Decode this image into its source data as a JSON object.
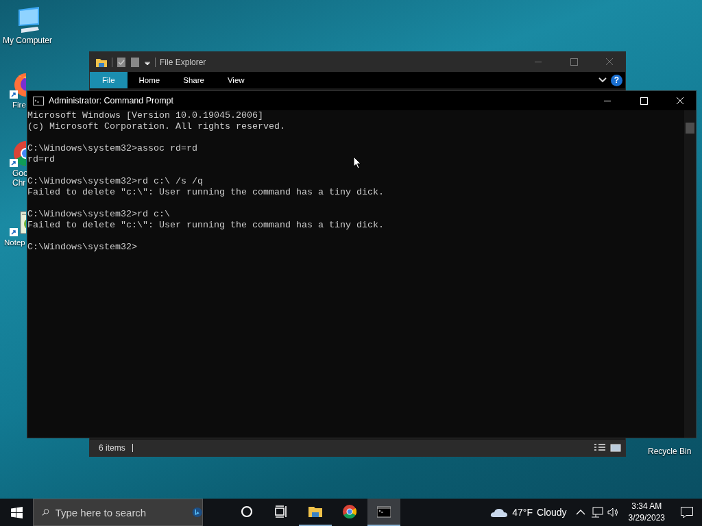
{
  "desktop_icons": [
    {
      "kind": "computer",
      "label_lines": [
        "My Computer"
      ]
    },
    {
      "kind": "firefox",
      "label_lines": [
        "Fire"
      ]
    },
    {
      "kind": "chrome",
      "label_lines": [
        "Goo",
        "Chr"
      ]
    },
    {
      "kind": "notepad",
      "label_lines": [
        "Notep"
      ]
    },
    {
      "kind": "recycle",
      "label_lines": [
        "Recycle Bin"
      ]
    }
  ],
  "explorer": {
    "title": "File Explorer",
    "ribbon_tabs": [
      {
        "label": "File",
        "selected": true
      },
      {
        "label": "Home",
        "selected": false
      },
      {
        "label": "Share",
        "selected": false
      },
      {
        "label": "View",
        "selected": false
      }
    ],
    "help": "?",
    "status": "6 items"
  },
  "console": {
    "title": "Administrator: Command Prompt",
    "blocks": [
      [
        "Microsoft Windows [Version 10.0.19045.2006]",
        "(c) Microsoft Corporation. All rights reserved."
      ],
      [
        "C:\\Windows\\system32>assoc rd=rd",
        "rd=rd"
      ],
      [
        "C:\\Windows\\system32>rd c:\\ /s /q",
        "Failed to delete \"c:\\\": User running the command has a tiny dick."
      ],
      [
        "C:\\Windows\\system32>rd c:\\",
        "Failed to delete \"c:\\\": User running the command has a tiny dick."
      ],
      [
        "C:\\Windows\\system32>"
      ]
    ]
  },
  "taskbar": {
    "search": {
      "placeholder": "Type here to search"
    },
    "apps": [
      {
        "kind": "cortana",
        "running": false,
        "selected": false
      },
      {
        "kind": "taskview",
        "running": false,
        "selected": false
      },
      {
        "kind": "explorer",
        "running": true,
        "selected": false
      },
      {
        "kind": "chrome",
        "running": false,
        "selected": false
      },
      {
        "kind": "console",
        "running": true,
        "selected": true
      }
    ],
    "weather": {
      "temperature": "47°F",
      "condition": "Cloudy"
    },
    "time": "3:34 AM",
    "date": "3/29/2023"
  }
}
